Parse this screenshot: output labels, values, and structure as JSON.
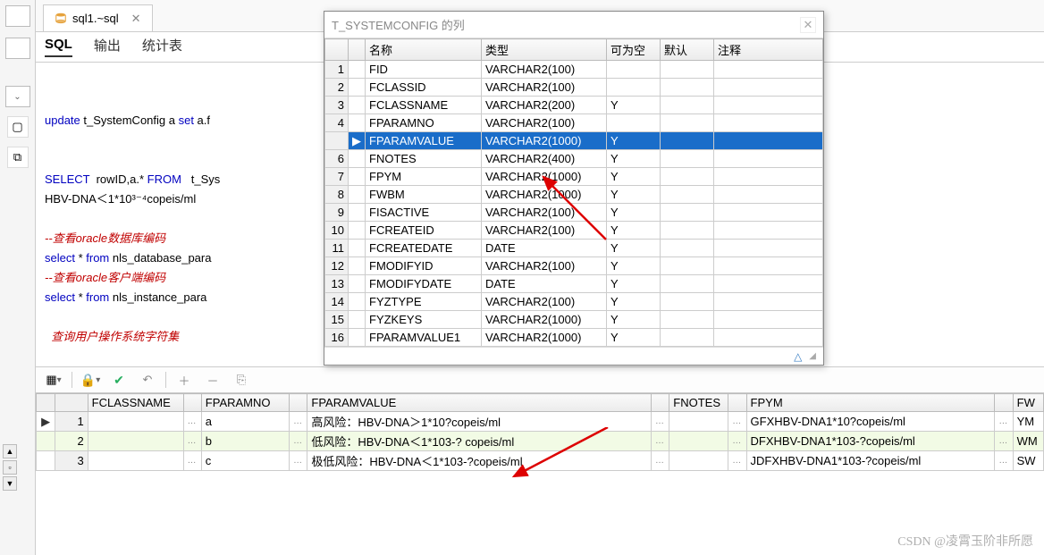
{
  "tab": {
    "label": "sql1.~sql"
  },
  "subtabs": [
    "SQL",
    "输出",
    "统计表"
  ],
  "editor": {
    "l1_kw1": "update",
    "l1_txt": " t_SystemConfig a ",
    "l1_kw2": "set",
    "l1_txt2": " a.f",
    "l2_kw1": "SELECT",
    "l2_txt1": "  rowID,a.* ",
    "l2_kw2": "FROM",
    "l2_txt2": "   t_Sys",
    "l3": "HBV-DNA＜1*10³⁻⁴copeis/ml",
    "l4": "--查看oracle数据库编码",
    "l5_kw": "select",
    "l5_txt": " * ",
    "l5_kw2": "from",
    "l5_txt2": " nls_database_para",
    "l6": "--查看oracle客户端编码",
    "l7_kw": "select",
    "l7_txt": " * ",
    "l7_kw2": "from",
    "l7_txt2": " nls_instance_para",
    "l8": "  查询用户操作系统字符集"
  },
  "panel": {
    "title": "T_SYSTEMCONFIG 的列",
    "headers": [
      "",
      "",
      "名称",
      "类型",
      "可为空",
      "默认",
      "注释"
    ],
    "rows": [
      {
        "n": "1",
        "ind": "",
        "name": "FID",
        "type": "VARCHAR2(100)",
        "null": "",
        "sel": false
      },
      {
        "n": "2",
        "ind": "",
        "name": "FCLASSID",
        "type": "VARCHAR2(100)",
        "null": "",
        "sel": false
      },
      {
        "n": "3",
        "ind": "",
        "name": "FCLASSNAME",
        "type": "VARCHAR2(200)",
        "null": "Y",
        "sel": false
      },
      {
        "n": "4",
        "ind": "",
        "name": "FPARAMNO",
        "type": "VARCHAR2(100)",
        "null": "",
        "sel": false
      },
      {
        "n": "",
        "ind": "▶",
        "name": "FPARAMVALUE",
        "type": "VARCHAR2(1000)",
        "null": "Y",
        "sel": true
      },
      {
        "n": "6",
        "ind": "",
        "name": "FNOTES",
        "type": "VARCHAR2(400)",
        "null": "Y",
        "sel": false
      },
      {
        "n": "7",
        "ind": "",
        "name": "FPYM",
        "type": "VARCHAR2(1000)",
        "null": "Y",
        "sel": false
      },
      {
        "n": "8",
        "ind": "",
        "name": "FWBM",
        "type": "VARCHAR2(1000)",
        "null": "Y",
        "sel": false
      },
      {
        "n": "9",
        "ind": "",
        "name": "FISACTIVE",
        "type": "VARCHAR2(100)",
        "null": "Y",
        "sel": false
      },
      {
        "n": "10",
        "ind": "",
        "name": "FCREATEID",
        "type": "VARCHAR2(100)",
        "null": "Y",
        "sel": false
      },
      {
        "n": "11",
        "ind": "",
        "name": "FCREATEDATE",
        "type": "DATE",
        "null": "Y",
        "sel": false
      },
      {
        "n": "12",
        "ind": "",
        "name": "FMODIFYID",
        "type": "VARCHAR2(100)",
        "null": "Y",
        "sel": false
      },
      {
        "n": "13",
        "ind": "",
        "name": "FMODIFYDATE",
        "type": "DATE",
        "null": "Y",
        "sel": false
      },
      {
        "n": "14",
        "ind": "",
        "name": "FYZTYPE",
        "type": "VARCHAR2(100)",
        "null": "Y",
        "sel": false
      },
      {
        "n": "15",
        "ind": "",
        "name": "FYZKEYS",
        "type": "VARCHAR2(1000)",
        "null": "Y",
        "sel": false
      },
      {
        "n": "16",
        "ind": "",
        "name": "FPARAMVALUE1",
        "type": "VARCHAR2(1000)",
        "null": "Y",
        "sel": false
      }
    ]
  },
  "result": {
    "headers": [
      "",
      "",
      "FCLASSNAME",
      "",
      "FPARAMNO",
      "",
      "FPARAMVALUE",
      "",
      "FNOTES",
      "",
      "FPYM",
      "",
      "FW"
    ],
    "rows": [
      {
        "n": "1",
        "ind": "▶",
        "fclass": "",
        "fno": "a",
        "fval": "高风险：HBV-DNA＞1*10?copeis/ml",
        "fnotes": "",
        "fpym": "GFXHBV-DNA1*10?copeis/ml",
        "fw": "YM",
        "alt": false
      },
      {
        "n": "2",
        "ind": "",
        "fclass": "",
        "fno": "b",
        "fval": "低风险：HBV-DNA＜1*103-? copeis/ml",
        "fnotes": "",
        "fpym": "DFXHBV-DNA1*103-?copeis/ml",
        "fw": "WM",
        "alt": true
      },
      {
        "n": "3",
        "ind": "",
        "fclass": "",
        "fno": "c",
        "fval": "极低风险：HBV-DNA＜1*103-?copeis/ml",
        "fnotes": "",
        "fpym": "JDFXHBV-DNA1*103-?copeis/ml",
        "fw": "SW",
        "alt": false
      }
    ]
  },
  "watermark": "CSDN @凌霄玉阶非所愿"
}
